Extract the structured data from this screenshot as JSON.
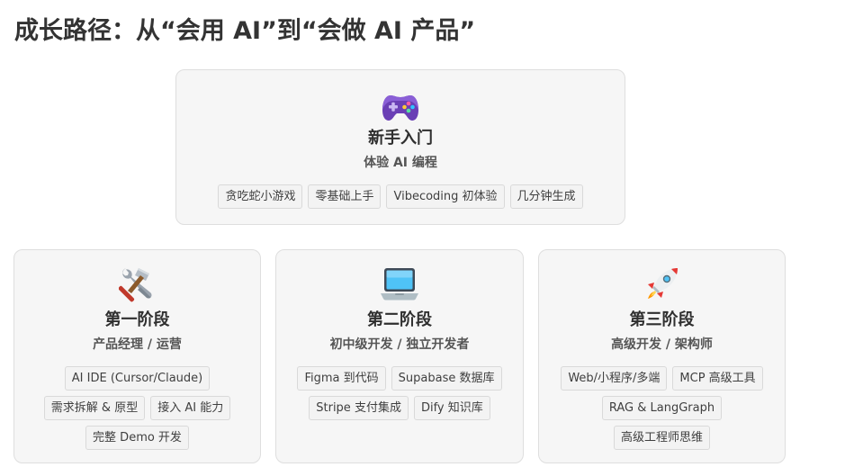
{
  "page": {
    "title": "成长路径：从“会用 AI”到“会做 AI 产品”"
  },
  "intro": {
    "icon": "gamepad-icon",
    "title": "新手入门",
    "subtitle": "体验 AI 编程",
    "tags": [
      "贪吃蛇小游戏",
      "零基础上手",
      "Vibecoding 初体验",
      "几分钟生成"
    ]
  },
  "stages": [
    {
      "icon": "tools-icon",
      "title": "第一阶段",
      "subtitle": "产品经理 / 运营",
      "tags": [
        "AI IDE (Cursor/Claude)",
        "需求拆解 & 原型",
        "接入 AI 能力",
        "完整 Demo 开发"
      ]
    },
    {
      "icon": "laptop-icon",
      "title": "第二阶段",
      "subtitle": "初中级开发 / 独立开发者",
      "tags": [
        "Figma 到代码",
        "Supabase 数据库",
        "Stripe 支付集成",
        "Dify 知识库"
      ]
    },
    {
      "icon": "rocket-icon",
      "title": "第三阶段",
      "subtitle": "高级开发 / 架构师",
      "tags": [
        "Web/小程序/多端",
        "MCP 高级工具",
        "RAG & LangGraph",
        "高级工程师思维"
      ]
    }
  ],
  "colors": {
    "card_background": "#f6f6f6",
    "card_border": "#dedede",
    "tag_border": "#d9d9d9",
    "title_text": "#333333"
  }
}
